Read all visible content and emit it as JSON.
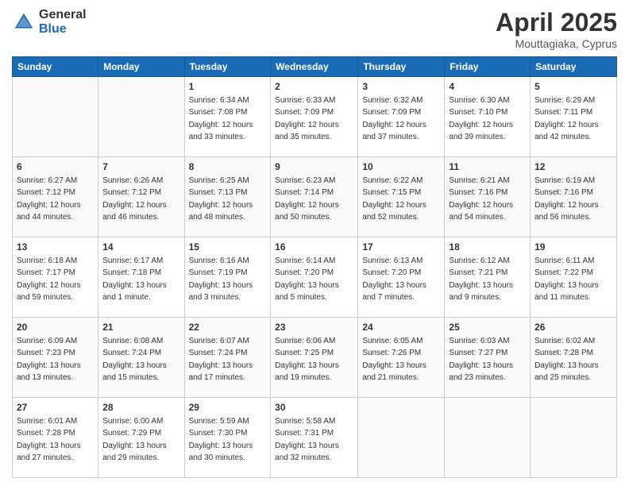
{
  "header": {
    "logo_general": "General",
    "logo_blue": "Blue",
    "title": "April 2025",
    "subtitle": "Mouttagiaka, Cyprus"
  },
  "calendar": {
    "weekdays": [
      "Sunday",
      "Monday",
      "Tuesday",
      "Wednesday",
      "Thursday",
      "Friday",
      "Saturday"
    ],
    "weeks": [
      [
        {
          "day": "",
          "info": ""
        },
        {
          "day": "",
          "info": ""
        },
        {
          "day": "1",
          "info": "Sunrise: 6:34 AM\nSunset: 7:08 PM\nDaylight: 12 hours and 33 minutes."
        },
        {
          "day": "2",
          "info": "Sunrise: 6:33 AM\nSunset: 7:09 PM\nDaylight: 12 hours and 35 minutes."
        },
        {
          "day": "3",
          "info": "Sunrise: 6:32 AM\nSunset: 7:09 PM\nDaylight: 12 hours and 37 minutes."
        },
        {
          "day": "4",
          "info": "Sunrise: 6:30 AM\nSunset: 7:10 PM\nDaylight: 12 hours and 39 minutes."
        },
        {
          "day": "5",
          "info": "Sunrise: 6:29 AM\nSunset: 7:11 PM\nDaylight: 12 hours and 42 minutes."
        }
      ],
      [
        {
          "day": "6",
          "info": "Sunrise: 6:27 AM\nSunset: 7:12 PM\nDaylight: 12 hours and 44 minutes."
        },
        {
          "day": "7",
          "info": "Sunrise: 6:26 AM\nSunset: 7:12 PM\nDaylight: 12 hours and 46 minutes."
        },
        {
          "day": "8",
          "info": "Sunrise: 6:25 AM\nSunset: 7:13 PM\nDaylight: 12 hours and 48 minutes."
        },
        {
          "day": "9",
          "info": "Sunrise: 6:23 AM\nSunset: 7:14 PM\nDaylight: 12 hours and 50 minutes."
        },
        {
          "day": "10",
          "info": "Sunrise: 6:22 AM\nSunset: 7:15 PM\nDaylight: 12 hours and 52 minutes."
        },
        {
          "day": "11",
          "info": "Sunrise: 6:21 AM\nSunset: 7:16 PM\nDaylight: 12 hours and 54 minutes."
        },
        {
          "day": "12",
          "info": "Sunrise: 6:19 AM\nSunset: 7:16 PM\nDaylight: 12 hours and 56 minutes."
        }
      ],
      [
        {
          "day": "13",
          "info": "Sunrise: 6:18 AM\nSunset: 7:17 PM\nDaylight: 12 hours and 59 minutes."
        },
        {
          "day": "14",
          "info": "Sunrise: 6:17 AM\nSunset: 7:18 PM\nDaylight: 13 hours and 1 minute."
        },
        {
          "day": "15",
          "info": "Sunrise: 6:16 AM\nSunset: 7:19 PM\nDaylight: 13 hours and 3 minutes."
        },
        {
          "day": "16",
          "info": "Sunrise: 6:14 AM\nSunset: 7:20 PM\nDaylight: 13 hours and 5 minutes."
        },
        {
          "day": "17",
          "info": "Sunrise: 6:13 AM\nSunset: 7:20 PM\nDaylight: 13 hours and 7 minutes."
        },
        {
          "day": "18",
          "info": "Sunrise: 6:12 AM\nSunset: 7:21 PM\nDaylight: 13 hours and 9 minutes."
        },
        {
          "day": "19",
          "info": "Sunrise: 6:11 AM\nSunset: 7:22 PM\nDaylight: 13 hours and 11 minutes."
        }
      ],
      [
        {
          "day": "20",
          "info": "Sunrise: 6:09 AM\nSunset: 7:23 PM\nDaylight: 13 hours and 13 minutes."
        },
        {
          "day": "21",
          "info": "Sunrise: 6:08 AM\nSunset: 7:24 PM\nDaylight: 13 hours and 15 minutes."
        },
        {
          "day": "22",
          "info": "Sunrise: 6:07 AM\nSunset: 7:24 PM\nDaylight: 13 hours and 17 minutes."
        },
        {
          "day": "23",
          "info": "Sunrise: 6:06 AM\nSunset: 7:25 PM\nDaylight: 13 hours and 19 minutes."
        },
        {
          "day": "24",
          "info": "Sunrise: 6:05 AM\nSunset: 7:26 PM\nDaylight: 13 hours and 21 minutes."
        },
        {
          "day": "25",
          "info": "Sunrise: 6:03 AM\nSunset: 7:27 PM\nDaylight: 13 hours and 23 minutes."
        },
        {
          "day": "26",
          "info": "Sunrise: 6:02 AM\nSunset: 7:28 PM\nDaylight: 13 hours and 25 minutes."
        }
      ],
      [
        {
          "day": "27",
          "info": "Sunrise: 6:01 AM\nSunset: 7:28 PM\nDaylight: 13 hours and 27 minutes."
        },
        {
          "day": "28",
          "info": "Sunrise: 6:00 AM\nSunset: 7:29 PM\nDaylight: 13 hours and 29 minutes."
        },
        {
          "day": "29",
          "info": "Sunrise: 5:59 AM\nSunset: 7:30 PM\nDaylight: 13 hours and 30 minutes."
        },
        {
          "day": "30",
          "info": "Sunrise: 5:58 AM\nSunset: 7:31 PM\nDaylight: 13 hours and 32 minutes."
        },
        {
          "day": "",
          "info": ""
        },
        {
          "day": "",
          "info": ""
        },
        {
          "day": "",
          "info": ""
        }
      ]
    ]
  }
}
